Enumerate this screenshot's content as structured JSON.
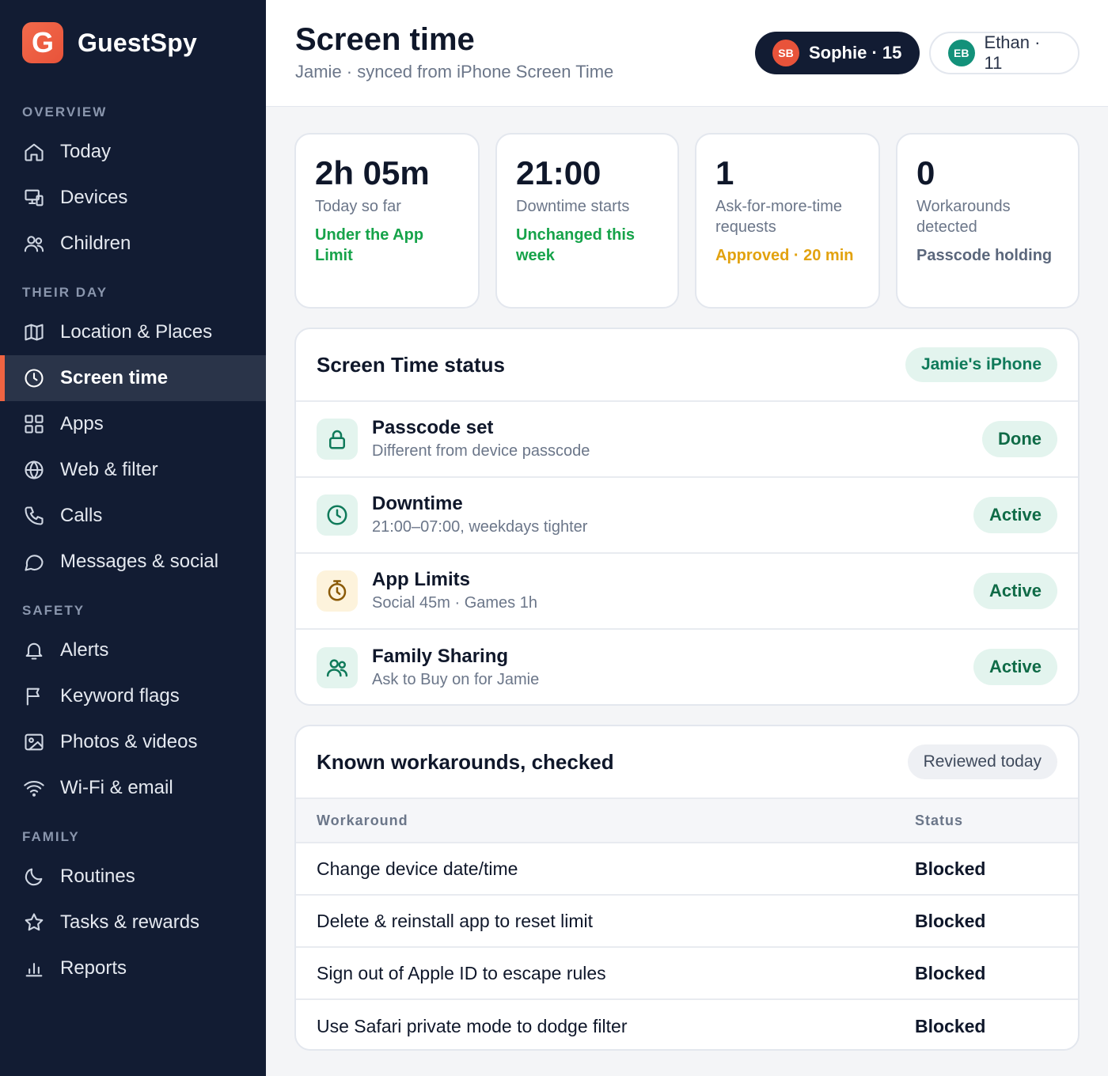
{
  "brand": {
    "logo_letter": "G",
    "name": "GuestSpy"
  },
  "sidebar": {
    "sections": [
      {
        "label": "OVERVIEW",
        "items": [
          {
            "label": "Today",
            "icon": "home-icon"
          },
          {
            "label": "Devices",
            "icon": "devices-icon"
          },
          {
            "label": "Children",
            "icon": "users-icon"
          }
        ]
      },
      {
        "label": "THEIR DAY",
        "items": [
          {
            "label": "Location & Places",
            "icon": "map-icon"
          },
          {
            "label": "Screen time",
            "icon": "clock-icon",
            "active": true
          },
          {
            "label": "Apps",
            "icon": "grid-icon"
          },
          {
            "label": "Web & filter",
            "icon": "globe-icon"
          },
          {
            "label": "Calls",
            "icon": "phone-icon"
          },
          {
            "label": "Messages & social",
            "icon": "chat-icon"
          }
        ]
      },
      {
        "label": "SAFETY",
        "items": [
          {
            "label": "Alerts",
            "icon": "bell-icon"
          },
          {
            "label": "Keyword flags",
            "icon": "flag-icon"
          },
          {
            "label": "Photos & videos",
            "icon": "image-icon"
          },
          {
            "label": "Wi-Fi & email",
            "icon": "wifi-icon"
          }
        ]
      },
      {
        "label": "FAMILY",
        "items": [
          {
            "label": "Routines",
            "icon": "moon-icon"
          },
          {
            "label": "Tasks & rewards",
            "icon": "star-icon"
          },
          {
            "label": "Reports",
            "icon": "bar-chart-icon"
          }
        ]
      }
    ]
  },
  "header": {
    "title": "Screen time",
    "subtitle": "Jamie · synced from iPhone Screen Time",
    "children": [
      {
        "initials": "SB",
        "label": "Sophie · 15",
        "selected": true
      },
      {
        "initials": "EB",
        "label": "Ethan · 11",
        "selected": false
      }
    ]
  },
  "stats": [
    {
      "value": "2h 05m",
      "label": "Today so far",
      "note": "Under the App Limit",
      "note_color": "#16a34a"
    },
    {
      "value": "21:00",
      "label": "Downtime starts",
      "note": "Unchanged this week",
      "note_color": "#16a34a"
    },
    {
      "value": "1",
      "label": "Ask-for-more-time requests",
      "note": "Approved · 20 min",
      "note_color": "#e2a20f"
    },
    {
      "value": "0",
      "label": "Workarounds detected",
      "note": "Passcode holding",
      "note_color": "#5b677c"
    }
  ],
  "status_panel": {
    "title": "Screen Time status",
    "device_pill": "Jamie's iPhone",
    "rows": [
      {
        "icon": "lock-icon",
        "title": "Passcode set",
        "desc": "Different from device passcode",
        "badge": "Done"
      },
      {
        "icon": "clock-icon",
        "title": "Downtime",
        "desc": "21:00–07:00, weekdays tighter",
        "badge": "Active"
      },
      {
        "icon": "stopwatch-icon",
        "title": "App Limits",
        "desc": "Social 45m · Games 1h",
        "badge": "Active"
      },
      {
        "icon": "family-icon",
        "title": "Family Sharing",
        "desc": "Ask to Buy on for Jamie",
        "badge": "Active"
      }
    ]
  },
  "workarounds_panel": {
    "title": "Known workarounds, checked",
    "review_pill": "Reviewed today",
    "columns": [
      "Workaround",
      "Status"
    ],
    "rows": [
      {
        "workaround": "Change device date/time",
        "status": "Blocked"
      },
      {
        "workaround": "Delete & reinstall app to reset limit",
        "status": "Blocked"
      },
      {
        "workaround": "Sign out of Apple ID to escape rules",
        "status": "Blocked"
      },
      {
        "workaround": "Use Safari private mode to dodge filter",
        "status": "Blocked"
      }
    ]
  }
}
